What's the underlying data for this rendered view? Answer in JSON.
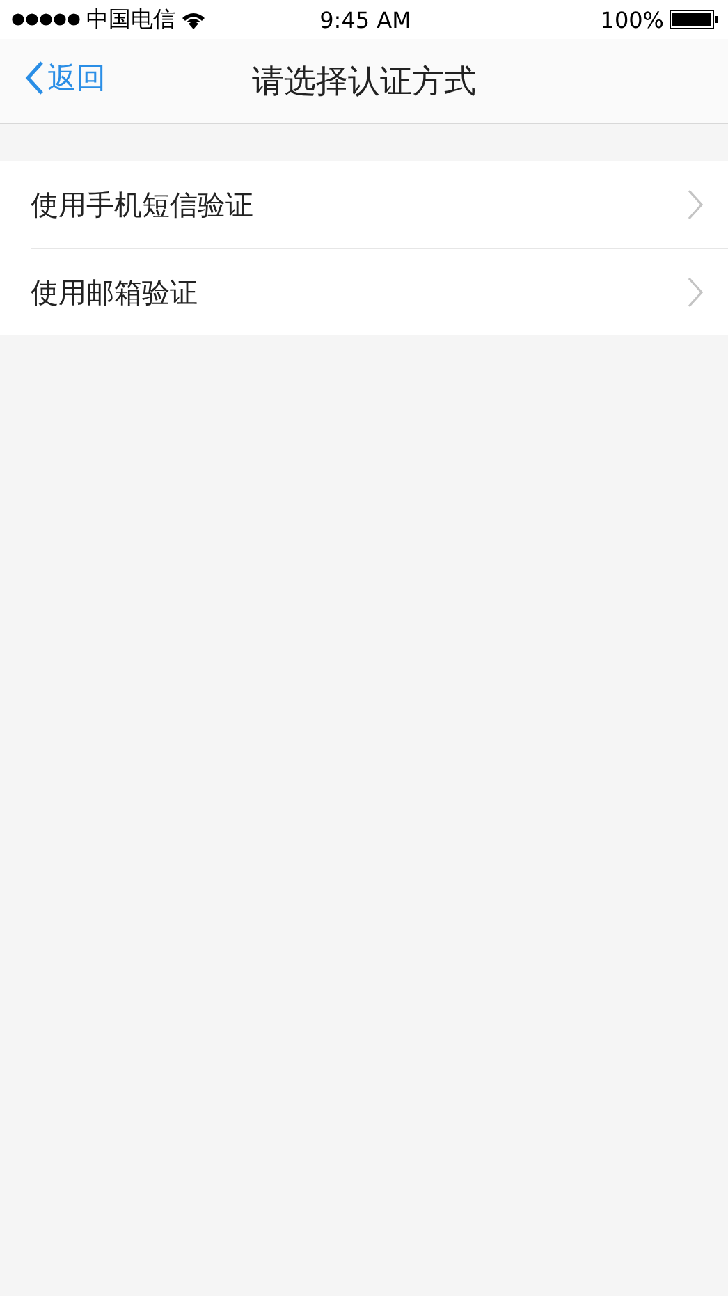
{
  "status_bar": {
    "carrier": "中国电信",
    "time": "9:45 AM",
    "battery": "100%"
  },
  "nav_bar": {
    "back": "返回",
    "title": "请选择认证方式"
  },
  "options": [
    {
      "label": "使用手机短信验证"
    },
    {
      "label": "使用邮箱验证"
    }
  ]
}
